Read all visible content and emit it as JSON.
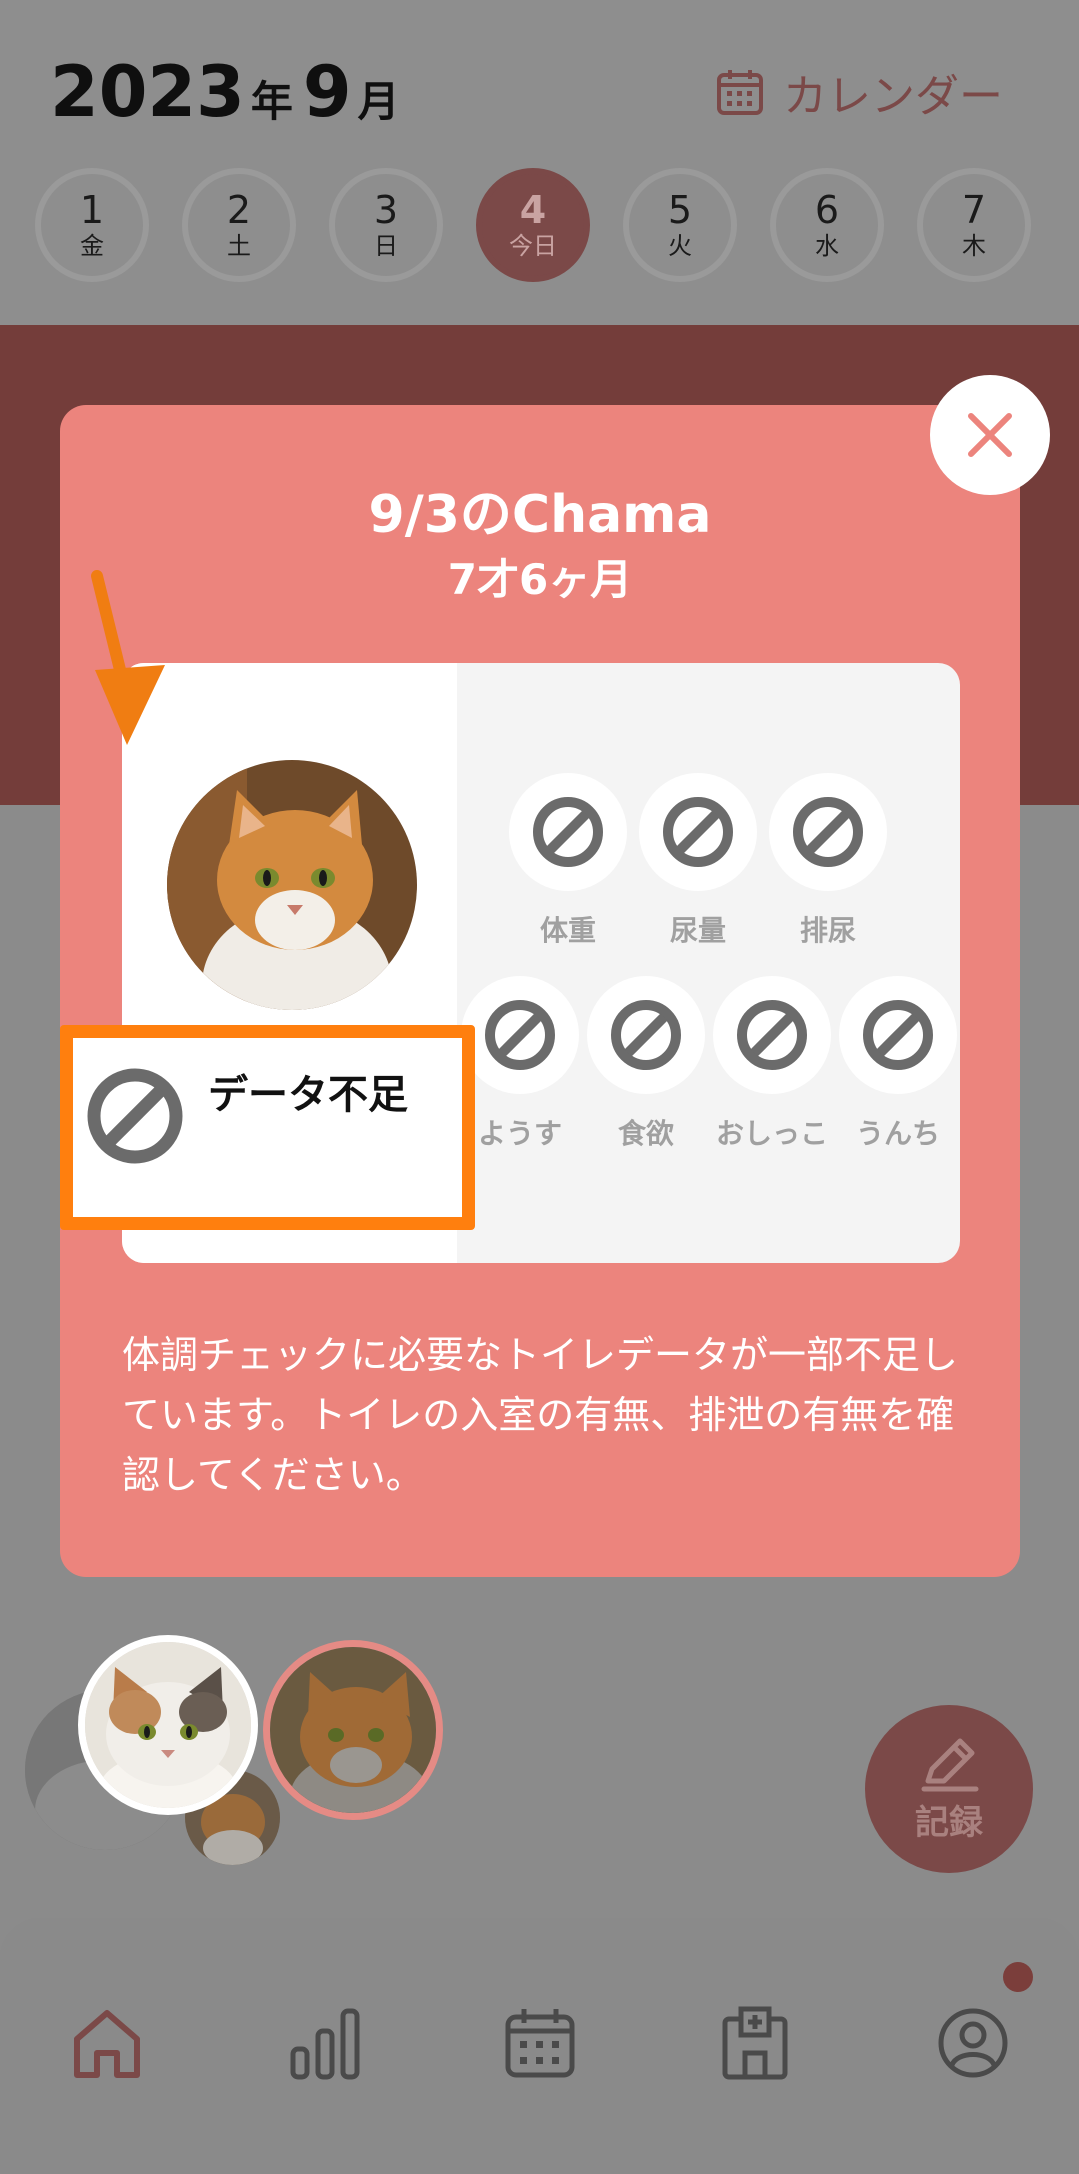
{
  "header": {
    "year": "2023",
    "year_unit": "年",
    "month": "9",
    "month_unit": "月",
    "calendar_label": "カレンダー"
  },
  "days": [
    {
      "num": "1",
      "weekday": "金"
    },
    {
      "num": "2",
      "weekday": "土"
    },
    {
      "num": "3",
      "weekday": "日"
    },
    {
      "num": "4",
      "weekday": "今日"
    },
    {
      "num": "5",
      "weekday": "火"
    },
    {
      "num": "6",
      "weekday": "水"
    },
    {
      "num": "7",
      "weekday": "木"
    }
  ],
  "modal": {
    "title": "9/3のChama",
    "age": "7才6ヶ月",
    "status_label": "データ不足",
    "indicators": [
      "体重",
      "尿量",
      "排尿",
      "ようす",
      "食欲",
      "おしっこ",
      "うんち"
    ],
    "message": "体調チェックに必要なトイレデータが一部不足しています。トイレの入室の有無、排泄の有無を確認してください。"
  },
  "fab": {
    "label": "記録"
  },
  "nav": {
    "items": [
      "home-icon",
      "chart-icon",
      "calendar-icon",
      "hospital-icon",
      "profile-icon"
    ],
    "active": "home-icon"
  },
  "colors": {
    "accent": "#ec847d",
    "dim_accent": "#7b4948",
    "highlight": "#ff7f0e"
  }
}
